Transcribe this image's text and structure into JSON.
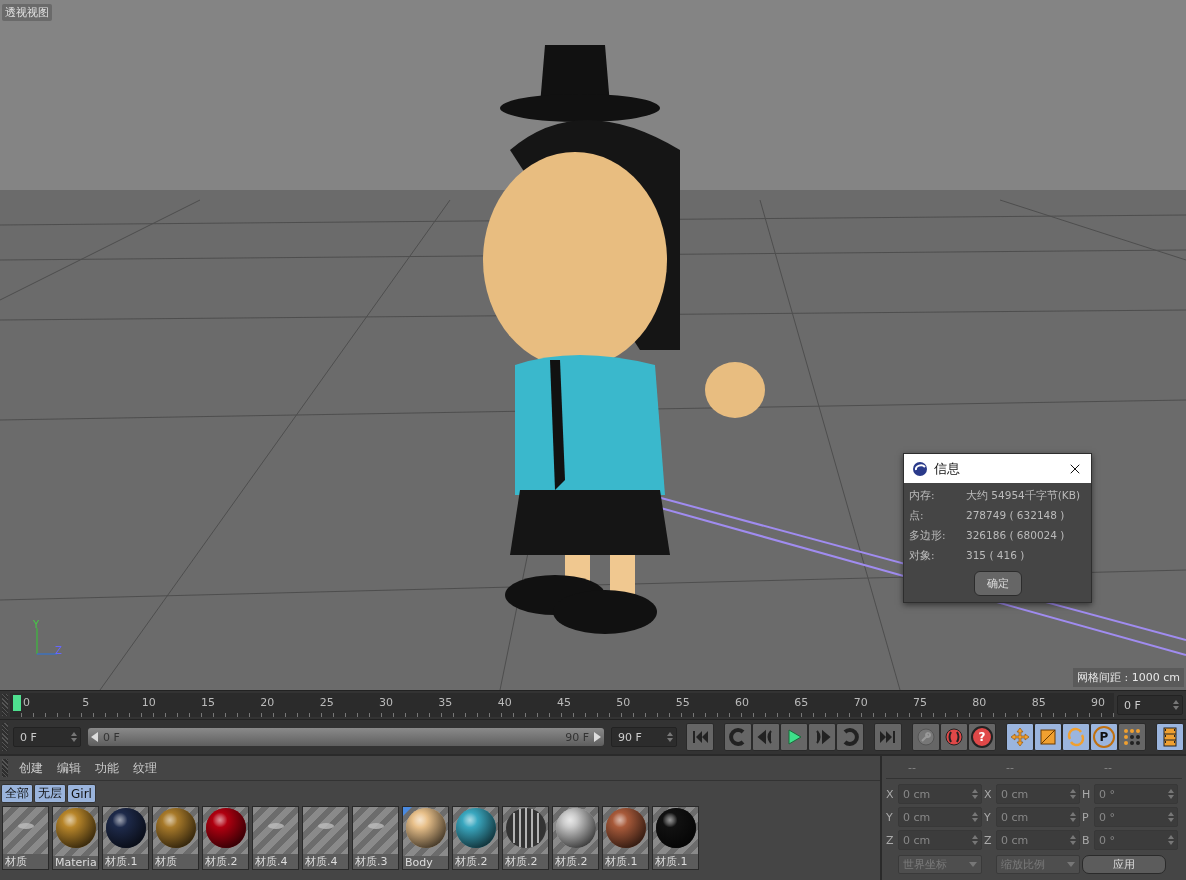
{
  "viewport": {
    "title": "透视视图",
    "grid_spacing": "网格间距 : 1000 cm",
    "axes": [
      "Y",
      "Z"
    ]
  },
  "info_dialog": {
    "title": "信息",
    "rows": [
      {
        "label": "内存:",
        "value": "大约 54954千字节(KB)"
      },
      {
        "label": "点:",
        "value": "278749 ( 632148 )"
      },
      {
        "label": "多边形:",
        "value": "326186 ( 680024 )"
      },
      {
        "label": "对象:",
        "value": "315 ( 416 )"
      }
    ],
    "ok_button": "确定"
  },
  "timeline": {
    "ticks": [
      "0",
      "5",
      "10",
      "15",
      "20",
      "25",
      "30",
      "35",
      "40",
      "45",
      "50",
      "55",
      "60",
      "65",
      "70",
      "75",
      "80",
      "85",
      "90"
    ],
    "level": 0,
    "current_frame": "0 F"
  },
  "transport": {
    "level": 1,
    "start_field": "0 F",
    "range_start": "0 F",
    "range_end": "90 F",
    "end_field": "90 F",
    "groups": [
      [
        {
          "kind": "first",
          "on": false
        }
      ],
      [
        {
          "kind": "prev-key",
          "on": false
        },
        {
          "kind": "step-back",
          "on": false
        },
        {
          "kind": "play",
          "on": false
        },
        {
          "kind": "step-forward",
          "on": false
        },
        {
          "kind": "next-key",
          "on": false
        }
      ],
      [
        {
          "kind": "last",
          "on": false
        }
      ],
      [
        {
          "kind": "key",
          "on": false
        },
        {
          "kind": "record",
          "on": false
        },
        {
          "kind": "help",
          "label": "?",
          "on": false
        }
      ],
      [
        {
          "kind": "move",
          "on": true
        },
        {
          "kind": "scale",
          "on": true
        },
        {
          "kind": "rotate",
          "on": true
        },
        {
          "kind": "param",
          "label": "P",
          "on": true
        },
        {
          "kind": "points",
          "on": false
        }
      ],
      [
        {
          "kind": "film",
          "on": true
        }
      ]
    ]
  },
  "materials": {
    "menu": [
      "创建",
      "编辑",
      "功能",
      "纹理"
    ],
    "layers": [
      "全部",
      "无层",
      "Girl"
    ],
    "items": [
      {
        "name": "材质",
        "kind": "decal",
        "selected": false
      },
      {
        "name": "Materia",
        "kind": "sphere",
        "color": "#b8862a",
        "selected": false
      },
      {
        "name": "材质.1",
        "kind": "sphere",
        "color": "#1e2a4a",
        "selected": false
      },
      {
        "name": "材质",
        "kind": "sphere",
        "color": "#a87a2a",
        "selected": false
      },
      {
        "name": "材质.2",
        "kind": "sphere",
        "color": "#b00010",
        "selected": false
      },
      {
        "name": "材质.4",
        "kind": "decal",
        "selected": false
      },
      {
        "name": "材质.4",
        "kind": "decal",
        "selected": false
      },
      {
        "name": "材质.3",
        "kind": "decal",
        "selected": false
      },
      {
        "name": "Body",
        "kind": "sphere",
        "color": "#e8c08a",
        "selected": true
      },
      {
        "name": "材质.2",
        "kind": "sphere",
        "color": "#3aa8c0",
        "selected": false
      },
      {
        "name": "材质.2",
        "kind": "lined",
        "color": "#333333",
        "selected": false
      },
      {
        "name": "材质.2",
        "kind": "sphere",
        "color": "#c8c8c8",
        "selected": false
      },
      {
        "name": "材质.1",
        "kind": "sphere",
        "color": "#a85a3a",
        "selected": false
      },
      {
        "name": "材质.1",
        "kind": "sphere",
        "color": "#111111",
        "selected": false
      }
    ]
  },
  "coordinates": {
    "headers": [
      "--",
      "--",
      "--"
    ],
    "columns": [
      [
        {
          "axis": "X",
          "value": "0 cm"
        },
        {
          "axis": "Y",
          "value": "0 cm"
        },
        {
          "axis": "Z",
          "value": "0 cm"
        }
      ],
      [
        {
          "axis": "X",
          "value": "0 cm"
        },
        {
          "axis": "Y",
          "value": "0 cm"
        },
        {
          "axis": "Z",
          "value": "0 cm"
        }
      ],
      [
        {
          "axis": "H",
          "value": "0 °"
        },
        {
          "axis": "P",
          "value": "0 °"
        },
        {
          "axis": "B",
          "value": "0 °"
        }
      ]
    ],
    "dropdowns": [
      {
        "label": "世界坐标",
        "disabled": true
      },
      {
        "label": "缩放比例",
        "disabled": true
      }
    ],
    "apply_button": "应用"
  }
}
